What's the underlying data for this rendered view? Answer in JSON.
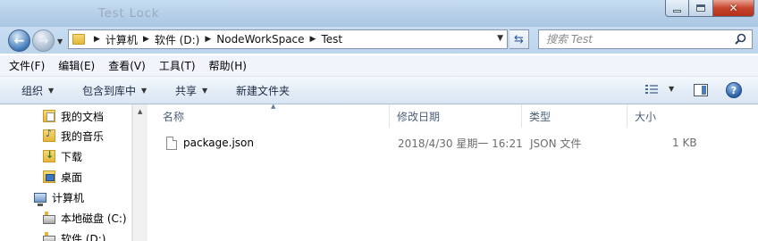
{
  "window": {
    "title_ghost": "Test  Lock",
    "buttons": {
      "minimize": "minimize",
      "maximize": "maximize",
      "close": "close"
    }
  },
  "address": {
    "crumbs": [
      "计算机",
      "软件 (D:)",
      "NodeWorkSpace",
      "Test"
    ]
  },
  "search": {
    "placeholder": "搜索 Test"
  },
  "menu": [
    "文件(F)",
    "编辑(E)",
    "查看(V)",
    "工具(T)",
    "帮助(H)"
  ],
  "toolbar": {
    "organize": "组织",
    "include_library": "包含到库中",
    "share": "共享",
    "new_folder": "新建文件夹"
  },
  "nav": {
    "items": [
      {
        "label": "我的文档",
        "icon": "documents-folder-icon"
      },
      {
        "label": "我的音乐",
        "icon": "music-folder-icon"
      },
      {
        "label": "下载",
        "icon": "downloads-folder-icon"
      },
      {
        "label": "桌面",
        "icon": "desktop-folder-icon"
      },
      {
        "label": "计算机",
        "icon": "computer-icon"
      },
      {
        "label": "本地磁盘 (C:)",
        "icon": "drive-icon"
      },
      {
        "label": "软件 (D:)",
        "icon": "drive-icon"
      }
    ]
  },
  "columns": {
    "name": "名称",
    "date": "修改日期",
    "type": "类型",
    "size": "大小"
  },
  "files": [
    {
      "name": "package.json",
      "date": "2018/4/30 星期一 16:21",
      "type": "JSON 文件",
      "size": "1 KB"
    }
  ]
}
